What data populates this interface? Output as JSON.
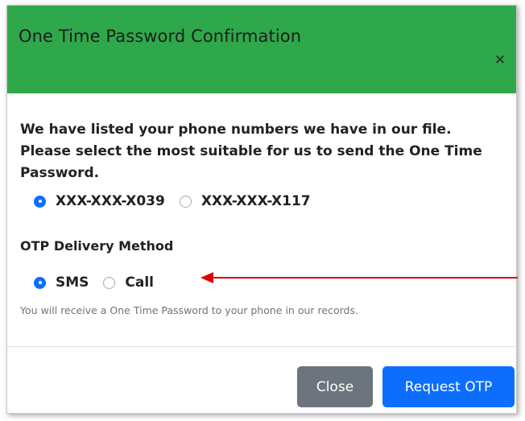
{
  "modal": {
    "title": "One Time Password Confirmation",
    "close_icon": "×",
    "intro_text": "We have listed your phone numbers we have in our file. Please select the most suitable for us to send the One Time Password.",
    "phone_options": [
      {
        "label": "XXX-XXX-X039",
        "selected": true
      },
      {
        "label": "XXX-XXX-X117",
        "selected": false
      }
    ],
    "delivery_label": "OTP Delivery Method",
    "delivery_options": [
      {
        "label": "SMS",
        "selected": true
      },
      {
        "label": "Call",
        "selected": false
      }
    ],
    "hint_text": "You will receive a One Time Password to your phone in our records.",
    "close_button": "Close",
    "request_button": "Request OTP"
  },
  "colors": {
    "header": "#2ea84a",
    "primary": "#0d6efd",
    "secondary": "#6c757d",
    "annotation_arrow": "#e00000"
  },
  "icons": {
    "close": "close-icon",
    "arrow": "red-arrow-annotation"
  }
}
